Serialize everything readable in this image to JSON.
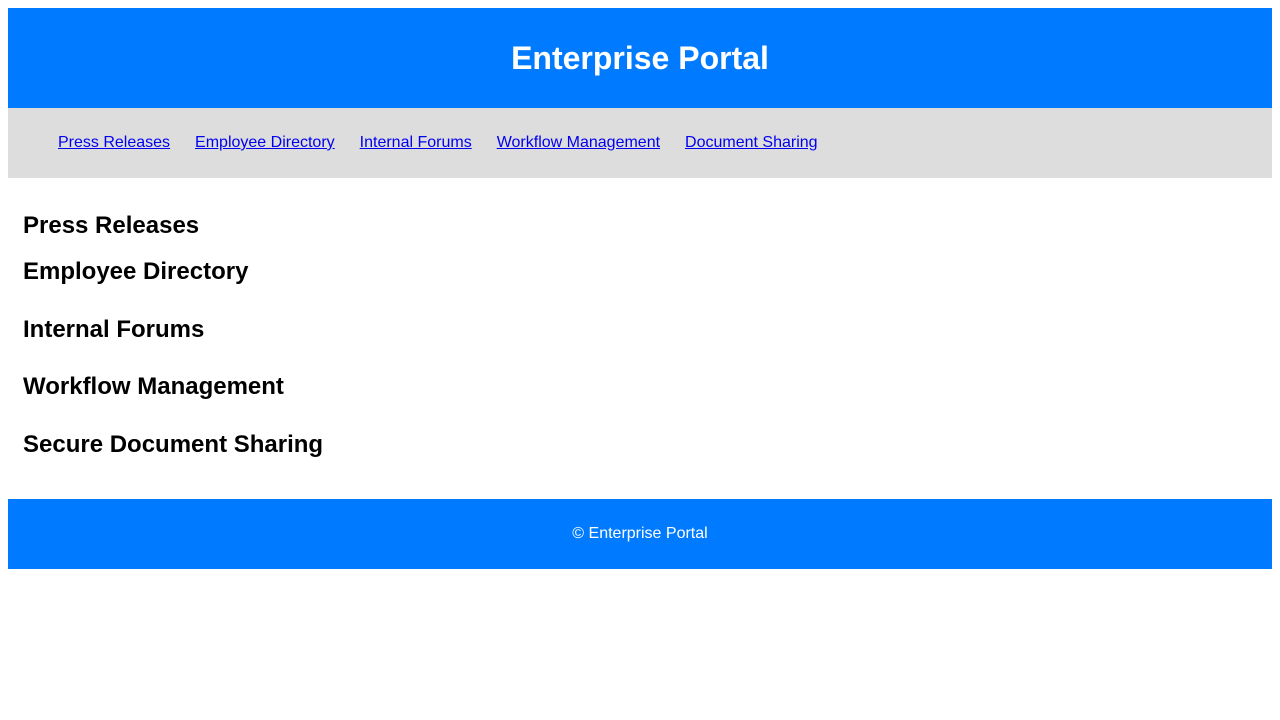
{
  "header": {
    "title": "Enterprise Portal"
  },
  "nav": {
    "items": [
      {
        "label": "Press Releases"
      },
      {
        "label": "Employee Directory"
      },
      {
        "label": "Internal Forums"
      },
      {
        "label": "Workflow Management"
      },
      {
        "label": "Document Sharing"
      }
    ]
  },
  "main": {
    "sections": [
      {
        "title": "Press Releases"
      },
      {
        "title": "Employee Directory"
      },
      {
        "title": "Internal Forums"
      },
      {
        "title": "Workflow Management"
      },
      {
        "title": "Secure Document Sharing"
      }
    ]
  },
  "footer": {
    "text": "© Enterprise Portal"
  },
  "colors": {
    "brand": "#007bff",
    "nav_background": "#dddddd",
    "link": "#0000ee"
  }
}
